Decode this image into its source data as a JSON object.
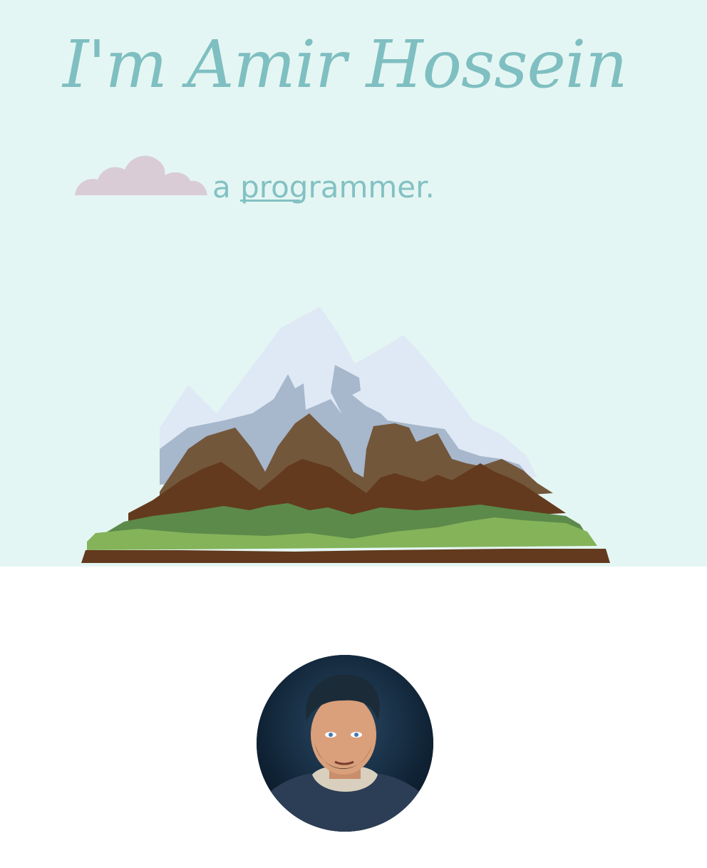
{
  "hero": {
    "title": "I'm Amir Hossein",
    "subtitle_prefix": "a ",
    "subtitle_typed": "programmer."
  },
  "colors": {
    "hero_background": "#e4f6f3",
    "title_color": "#7fbfc1",
    "cloud_color": "#d9ccd6",
    "page_background": "#ffffff"
  },
  "icons": {
    "cloud": "cloud-icon",
    "mountain": "mountain-illustration",
    "avatar": "profile-avatar"
  }
}
